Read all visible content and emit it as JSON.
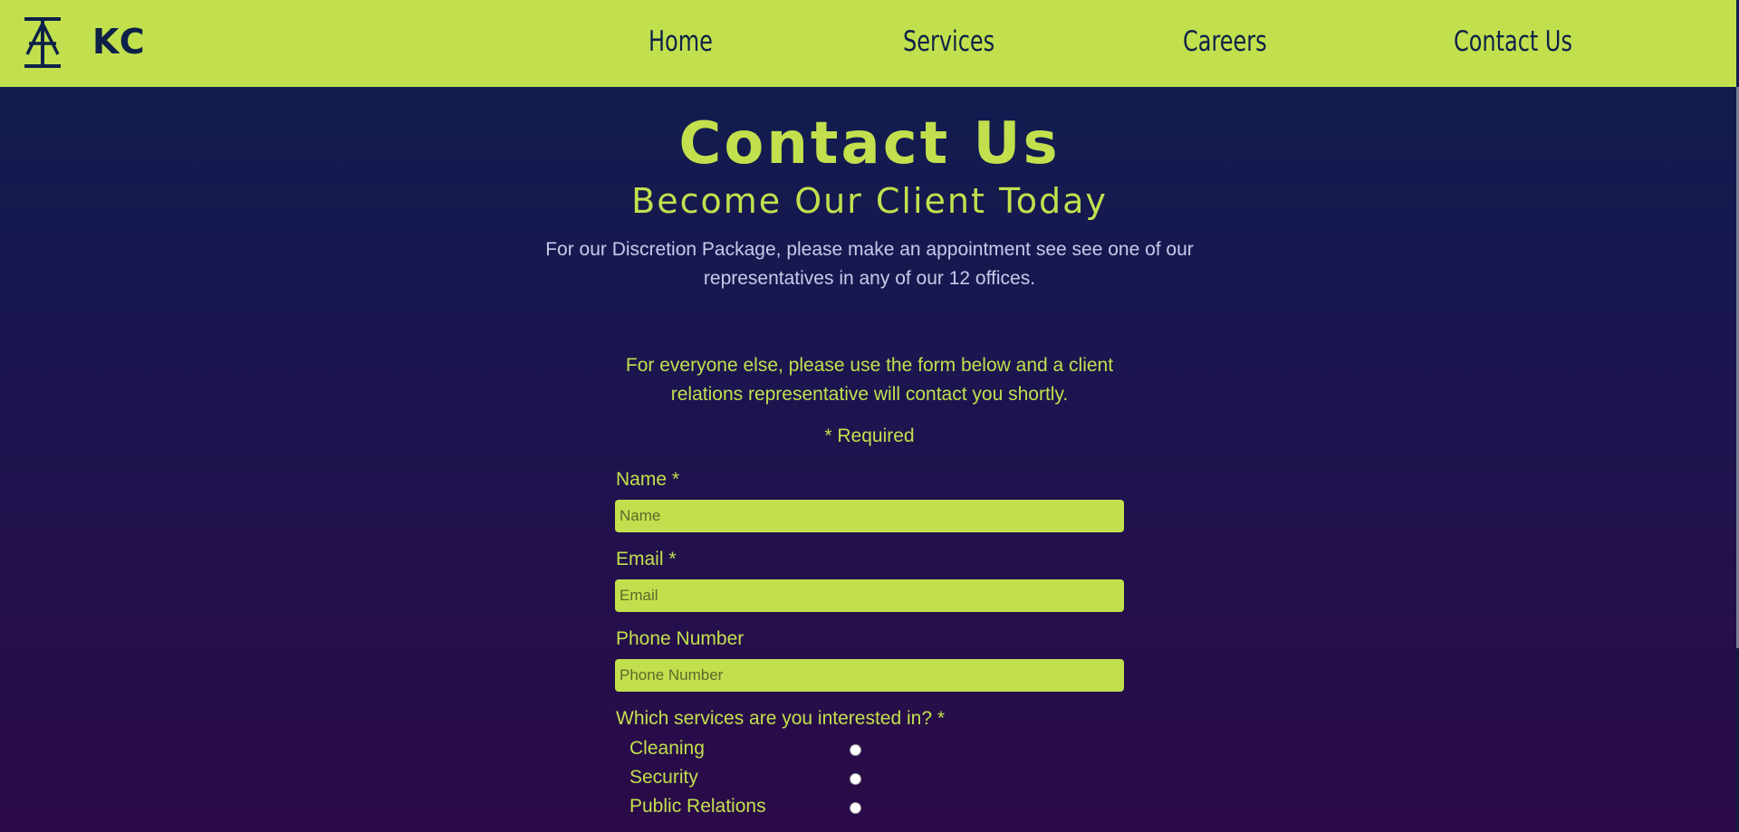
{
  "brand": {
    "logo": "kc-logo-icon",
    "name": "KC"
  },
  "nav": {
    "items": [
      {
        "label": "Home"
      },
      {
        "label": "Services"
      },
      {
        "label": "Careers"
      },
      {
        "label": "Contact Us"
      }
    ]
  },
  "hero": {
    "title": "Contact Us",
    "subtitle": "Become Our Client Today",
    "intro": "For our Discretion Package, please make an appointment see see one of our representatives in any of our 12 offices.",
    "intro2": "For everyone else, please use the form below and a client relations representative will contact you shortly."
  },
  "form": {
    "required_note": "* Required",
    "name": {
      "label": "Name *",
      "placeholder": "Name"
    },
    "email": {
      "label": "Email *",
      "placeholder": "Email"
    },
    "phone": {
      "label": "Phone Number",
      "placeholder": "Phone Number"
    },
    "services": {
      "label": "Which services are you interested in? *",
      "options": [
        {
          "label": "Cleaning"
        },
        {
          "label": "Security"
        },
        {
          "label": "Public Relations"
        }
      ]
    }
  },
  "colors": {
    "accent": "#c2e04d",
    "navy": "#0e2148",
    "bg_top": "#0e1f4e",
    "bg_bottom": "#2a0a47"
  }
}
